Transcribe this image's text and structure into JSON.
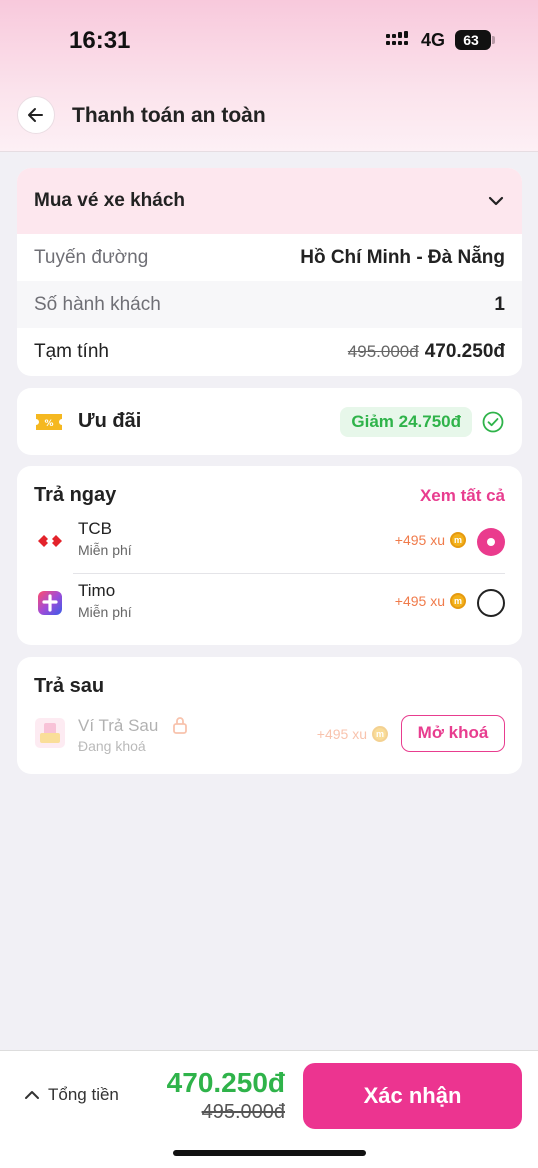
{
  "status_bar": {
    "time": "16:31",
    "network": "4G",
    "battery": "63"
  },
  "header": {
    "title": "Thanh toán an toàn"
  },
  "order": {
    "title": "Mua vé xe khách",
    "route_label": "Tuyến đường",
    "route_value": "Hồ Chí Minh - Đà Nẵng",
    "passengers_label": "Số hành khách",
    "passengers_value": "1",
    "subtotal_label": "Tạm tính",
    "subtotal_old": "495.000đ",
    "subtotal_new": "470.250đ"
  },
  "promo": {
    "label": "Ưu đãi",
    "badge": "Giảm 24.750đ"
  },
  "pay_now": {
    "title": "Trả ngay",
    "see_all": "Xem tất cả",
    "methods": [
      {
        "name": "TCB",
        "sub": "Miễn phí",
        "reward": "+495 xu",
        "selected": true
      },
      {
        "name": "Timo",
        "sub": "Miễn phí",
        "reward": "+495 xu",
        "selected": false
      }
    ]
  },
  "pay_later": {
    "title": "Trả sau",
    "name": "Ví Trả Sau",
    "sub": "Đang khoá",
    "reward": "+495 xu",
    "unlock_label": "Mở khoá"
  },
  "footer": {
    "total_label": "Tổng tiền",
    "total_new": "470.250đ",
    "total_old": "495.000đ",
    "confirm_label": "Xác nhận"
  },
  "colors": {
    "accent": "#ec3490",
    "success": "#2fb34a",
    "reward": "#f07b4b"
  }
}
